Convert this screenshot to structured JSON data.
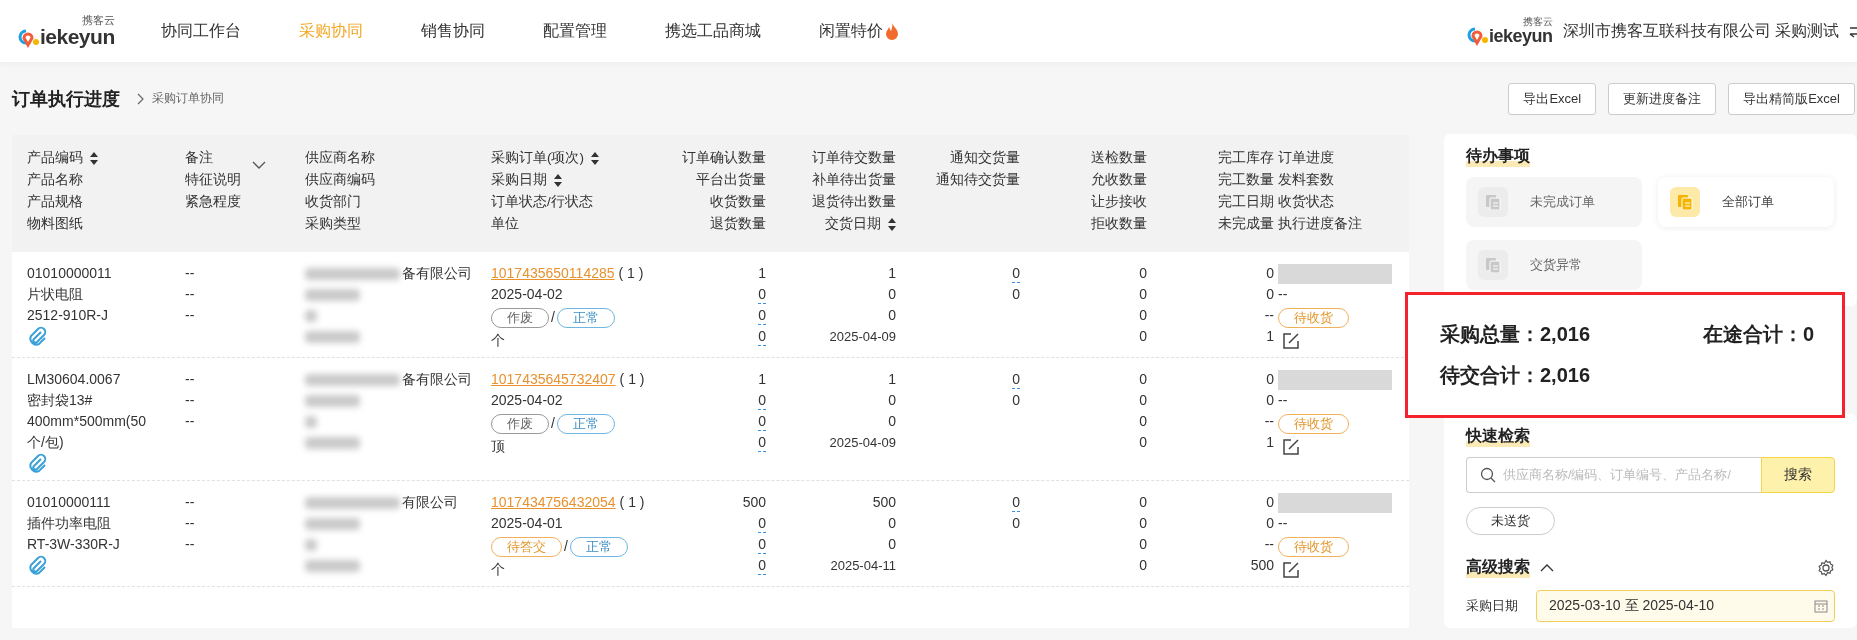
{
  "header": {
    "logo": {
      "wordmark": "iekeyun",
      "caption": "携客云"
    },
    "nav": [
      {
        "label": "协同工作台",
        "selected": false,
        "hot": false
      },
      {
        "label": "采购协同",
        "selected": true,
        "hot": false
      },
      {
        "label": "销售协同",
        "selected": false,
        "hot": false
      },
      {
        "label": "配置管理",
        "selected": false,
        "hot": false
      },
      {
        "label": "携选工品商城",
        "selected": false,
        "hot": false
      },
      {
        "label": "闲置特价",
        "selected": false,
        "hot": true
      }
    ],
    "company": {
      "logo": {
        "wordmark": "iekeyun",
        "caption": "携客云"
      },
      "name": "深圳市携客互联科技有限公司 采购测试"
    }
  },
  "page": {
    "title": "订单执行进度",
    "breadcrumb": "采购订单协同",
    "buttons": [
      "导出Excel",
      "更新进度备注",
      "导出精简版Excel"
    ]
  },
  "table": {
    "columns": [
      {
        "kind": "text",
        "lines": [
          {
            "text": "产品编码",
            "sortable": true
          },
          {
            "text": "产品名称",
            "sortable": false
          },
          {
            "text": "产品规格",
            "sortable": false
          },
          {
            "text": "物料图纸",
            "sortable": false
          }
        ]
      },
      {
        "kind": "text",
        "dropdown": true,
        "lines": [
          {
            "text": "备注",
            "sortable": false
          },
          {
            "text": "特征说明",
            "sortable": false
          },
          {
            "text": "紧急程度",
            "sortable": false
          }
        ]
      },
      {
        "kind": "text",
        "lines": [
          {
            "text": "供应商名称",
            "sortable": false
          },
          {
            "text": "供应商编码",
            "sortable": false
          },
          {
            "text": "收货部门",
            "sortable": false
          },
          {
            "text": "采购类型",
            "sortable": false
          }
        ]
      },
      {
        "kind": "text",
        "lines": [
          {
            "text": "采购订单(项次)",
            "sortable": true
          },
          {
            "text": "采购日期",
            "sortable": true
          },
          {
            "text": "订单状态/行状态",
            "sortable": false
          },
          {
            "text": "单位",
            "sortable": false
          }
        ]
      },
      {
        "kind": "number",
        "lines": [
          {
            "text": "订单确认数量",
            "sortable": false
          },
          {
            "text": "平台出货量",
            "sortable": false
          },
          {
            "text": "收货数量",
            "sortable": false
          },
          {
            "text": "退货数量",
            "sortable": false
          }
        ]
      },
      {
        "kind": "number",
        "lines": [
          {
            "text": "订单待交数量",
            "sortable": false
          },
          {
            "text": "补单待出货量",
            "sortable": false
          },
          {
            "text": "退货待出数量",
            "sortable": false
          },
          {
            "text": "交货日期",
            "sortable": true
          }
        ]
      },
      {
        "kind": "number",
        "lines": [
          {
            "text": "通知交货量",
            "sortable": false
          },
          {
            "text": "通知待交货量",
            "sortable": false
          }
        ]
      },
      {
        "kind": "number",
        "lines": [
          {
            "text": "送检数量",
            "sortable": false
          },
          {
            "text": "允收数量",
            "sortable": false
          },
          {
            "text": "让步接收",
            "sortable": false
          },
          {
            "text": "拒收数量",
            "sortable": false
          }
        ]
      },
      {
        "kind": "number",
        "lines": [
          {
            "text": "完工库存",
            "sortable": false
          },
          {
            "text": "完工数量",
            "sortable": false
          },
          {
            "text": "完工日期",
            "sortable": false
          },
          {
            "text": "未完成量",
            "sortable": false
          }
        ]
      },
      {
        "kind": "text",
        "lines": [
          {
            "text": "订单进度",
            "sortable": false
          },
          {
            "text": "发料套数",
            "sortable": false
          },
          {
            "text": "收货状态",
            "sortable": false
          },
          {
            "text": "执行进度备注",
            "sortable": false
          }
        ]
      }
    ],
    "rows": [
      {
        "product": {
          "code": "01010000011",
          "name": "片状电阻",
          "spec": "2512-910R-J"
        },
        "remarks": [
          "--",
          "--",
          "--"
        ],
        "supplier": {
          "name_visible": "备有限公司"
        },
        "order": {
          "number": "1017435650114285",
          "item": "( 1 )",
          "date": "2025-04-02",
          "separator": "/",
          "status": {
            "text": "作废",
            "kind": "void"
          },
          "line_status": {
            "text": "正常",
            "kind": "normal"
          },
          "unit": "个"
        },
        "numbers": [
          [
            {
              "text": "1",
              "link": false
            },
            {
              "text": "0",
              "link": true
            },
            {
              "text": "0",
              "link": true
            },
            {
              "text": "0",
              "link": true
            }
          ],
          [
            {
              "text": "1",
              "link": false
            },
            {
              "text": "0",
              "link": false
            },
            {
              "text": "0",
              "link": false
            },
            {
              "text": "2025-04-09",
              "link": false
            }
          ],
          [
            {
              "text": "0",
              "link": true
            },
            {
              "text": "0",
              "link": false
            }
          ],
          [
            {
              "text": "0",
              "link": false
            },
            {
              "text": "0",
              "link": false
            },
            {
              "text": "0",
              "link": false
            },
            {
              "text": "0",
              "link": false
            }
          ],
          [
            {
              "text": "0",
              "link": false
            },
            {
              "text": "0",
              "link": false
            },
            {
              "text": "--",
              "link": false
            },
            {
              "text": "1",
              "link": false
            }
          ]
        ],
        "progress": {
          "kits": "--",
          "receipt": {
            "text": "待收货",
            "kind": "awaiting"
          }
        }
      },
      {
        "product": {
          "code": "LM30604.0067",
          "name": "密封袋13#",
          "spec": "400mm*500mm(50个/包)"
        },
        "remarks": [
          "--",
          "--",
          "--"
        ],
        "supplier": {
          "name_visible": "备有限公司"
        },
        "order": {
          "number": "1017435645732407",
          "item": "( 1 )",
          "date": "2025-04-02",
          "separator": "/",
          "status": {
            "text": "作废",
            "kind": "void"
          },
          "line_status": {
            "text": "正常",
            "kind": "normal"
          },
          "unit": "顶"
        },
        "numbers": [
          [
            {
              "text": "1",
              "link": false
            },
            {
              "text": "0",
              "link": true
            },
            {
              "text": "0",
              "link": true
            },
            {
              "text": "0",
              "link": true
            }
          ],
          [
            {
              "text": "1",
              "link": false
            },
            {
              "text": "0",
              "link": false
            },
            {
              "text": "0",
              "link": false
            },
            {
              "text": "2025-04-09",
              "link": false
            }
          ],
          [
            {
              "text": "0",
              "link": true
            },
            {
              "text": "0",
              "link": false
            }
          ],
          [
            {
              "text": "0",
              "link": false
            },
            {
              "text": "0",
              "link": false
            },
            {
              "text": "0",
              "link": false
            },
            {
              "text": "0",
              "link": false
            }
          ],
          [
            {
              "text": "0",
              "link": false
            },
            {
              "text": "0",
              "link": false
            },
            {
              "text": "--",
              "link": false
            },
            {
              "text": "1",
              "link": false
            }
          ]
        ],
        "progress": {
          "kits": "--",
          "receipt": {
            "text": "待收货",
            "kind": "awaiting"
          }
        }
      },
      {
        "product": {
          "code": "01010000111",
          "name": "插件功率电阻",
          "spec": "RT-3W-330R-J"
        },
        "remarks": [
          "--",
          "--",
          "--"
        ],
        "supplier": {
          "name_visible": "有限公司"
        },
        "order": {
          "number": "1017434756432054",
          "item": "( 1 )",
          "date": "2025-04-01",
          "separator": "/",
          "status": {
            "text": "待答交",
            "kind": "pending"
          },
          "line_status": {
            "text": "正常",
            "kind": "normal"
          },
          "unit": "个"
        },
        "numbers": [
          [
            {
              "text": "500",
              "link": false
            },
            {
              "text": "0",
              "link": true
            },
            {
              "text": "0",
              "link": true
            },
            {
              "text": "0",
              "link": true
            }
          ],
          [
            {
              "text": "500",
              "link": false
            },
            {
              "text": "0",
              "link": false
            },
            {
              "text": "0",
              "link": false
            },
            {
              "text": "2025-04-11",
              "link": false
            }
          ],
          [
            {
              "text": "0",
              "link": true
            },
            {
              "text": "0",
              "link": false
            }
          ],
          [
            {
              "text": "0",
              "link": false
            },
            {
              "text": "0",
              "link": false
            },
            {
              "text": "0",
              "link": false
            },
            {
              "text": "0",
              "link": false
            }
          ],
          [
            {
              "text": "0",
              "link": false
            },
            {
              "text": "0",
              "link": false
            },
            {
              "text": "--",
              "link": false
            },
            {
              "text": "500",
              "link": false
            }
          ]
        ],
        "progress": {
          "kits": "--",
          "receipt": {
            "text": "待收货",
            "kind": "awaiting"
          }
        }
      }
    ]
  },
  "todo": {
    "title": "待办事项",
    "items": [
      {
        "label": "未完成订单",
        "selected": false
      },
      {
        "label": "全部订单",
        "selected": true
      },
      {
        "label": "交货异常",
        "selected": false
      }
    ]
  },
  "summary": [
    "采购总量：2,016",
    "在途合计：0",
    "待交合计：2,016"
  ],
  "quick_search": {
    "title": "快速检索",
    "placeholder": "供应商名称/编码、订单编号、产品名称/",
    "button": "搜索",
    "chips": [
      "未送货"
    ]
  },
  "advanced_search": {
    "title": "高级搜索",
    "expanded": true,
    "filters": [
      {
        "label": "采购日期",
        "value": "2025-03-10 至 2025-04-10"
      }
    ]
  }
}
